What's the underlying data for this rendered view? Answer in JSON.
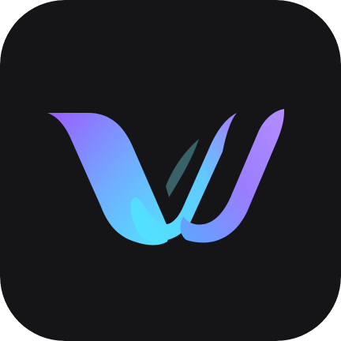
{
  "app_icon": {
    "logo": "stylized-w-ribbon-logo",
    "colors": {
      "background": "#151517",
      "purple": "#9b5cff",
      "violet": "#b48cff",
      "cyan": "#4fe6ff",
      "blue": "#5aa8ff"
    }
  }
}
